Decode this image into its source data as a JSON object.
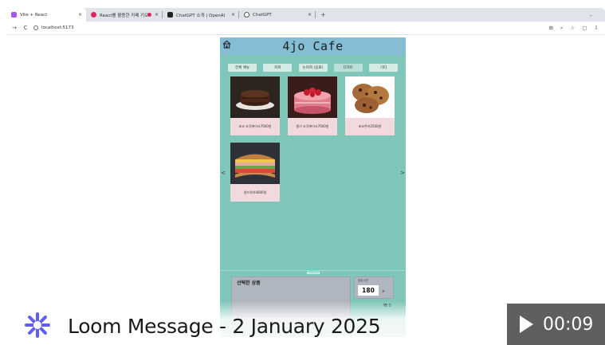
{
  "browser": {
    "tabs": [
      {
        "label": "Vite + React",
        "favicon_color": "#a855f7",
        "active": true
      },
      {
        "label": "React를 활용한 카페 키오",
        "favicon_color": "#e0245e"
      },
      {
        "label": "ChatGPT 소개 | OpenAI",
        "favicon_color": "#222222"
      },
      {
        "label": "ChatGPT",
        "favicon_color": "#555555"
      }
    ],
    "new_tab_label": "+",
    "close_label": "×",
    "minimize_label": "–",
    "url": "localhost:5173",
    "nav": {
      "back": "←",
      "forward": "→",
      "reload": "C"
    },
    "toolbar_icons": [
      "translate-icon",
      "zoom-icon",
      "star-icon",
      "extensions-icon",
      "download-icon"
    ],
    "toolbar_glyphs": [
      "⊞",
      "⌕",
      "☆",
      "▢",
      "⇩"
    ]
  },
  "app": {
    "title": "4jo Cafe",
    "header_color": "#84bdd4",
    "body_color": "#7fc7bb",
    "categories": [
      "전체 메뉴",
      "커피",
      "논커피 (음료)",
      "디저트",
      "기타"
    ],
    "active_category": 3,
    "products": [
      {
        "name": "초코 조각케이크7000원",
        "image": "chocolate-cake"
      },
      {
        "name": "딸기 조각케이크7000원",
        "image": "strawberry-cake"
      },
      {
        "name": "초코쿠키2500원",
        "image": "chocolate-cookies"
      },
      {
        "name": "샌드위치4800원",
        "image": "sandwich"
      }
    ],
    "prev_arrow": "<",
    "next_arrow": ">",
    "cart": {
      "title": "선택한 상품"
    },
    "timer": {
      "label": "남은시간",
      "value": "180",
      "unit": "초"
    },
    "total": "₩ 0"
  },
  "loom": {
    "title": "Loom Message - 2 January 2025",
    "duration": "00:09",
    "brand_color": "#625df5"
  }
}
